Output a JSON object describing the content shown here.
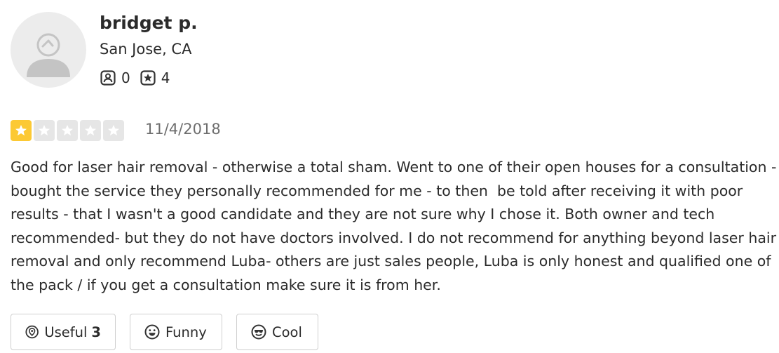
{
  "user": {
    "name": "bridget p.",
    "location": "San Jose, CA",
    "friends_count": "0",
    "reviews_count": "4"
  },
  "review": {
    "rating": 1,
    "rating_max": 5,
    "date": "11/4/2018",
    "text": "Good for laser hair removal - otherwise a total sham. Went to one of their open houses for a consultation - bought the service they personally recommended for me - to then  be told after receiving it with poor results - that I wasn't a good candidate and they are not sure why I chose it. Both owner and tech recommended- but they do not have doctors involved. I do not recommend for anything beyond laser hair removal and only recommend Luba- others are just sales people, Luba is only honest and qualified one of the pack / if you get a consultation make sure it is from her."
  },
  "reactions": {
    "useful_label": "Useful",
    "useful_count": "3",
    "funny_label": "Funny",
    "cool_label": "Cool"
  },
  "icons": {
    "friends": "friends-icon",
    "reviews": "review-star-icon",
    "useful": "lightbulb-icon",
    "funny": "smile-icon",
    "cool": "sunglasses-icon"
  },
  "colors": {
    "star_filled": "#fcc934",
    "star_empty": "#e6e6e6",
    "text": "#2b2b2b",
    "muted": "#6e6e6e",
    "border": "#cfcfcf"
  }
}
